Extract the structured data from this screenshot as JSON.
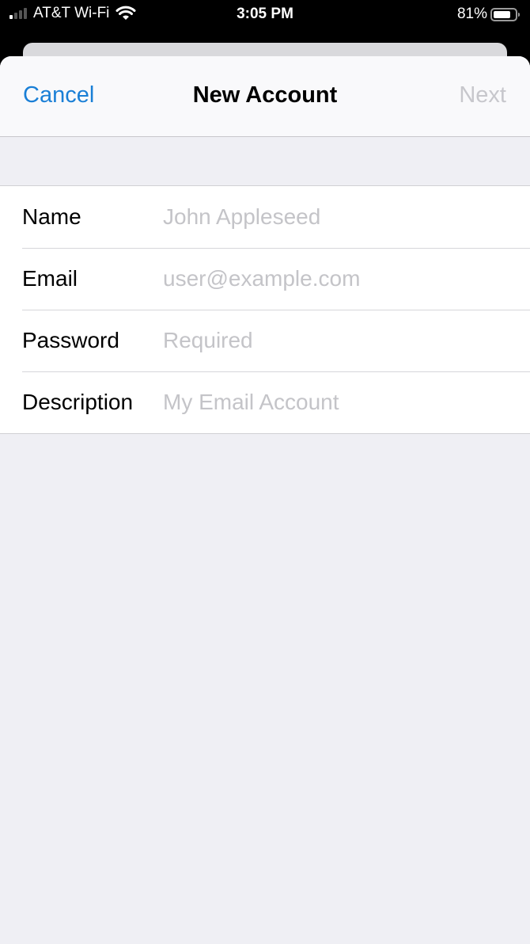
{
  "status_bar": {
    "carrier": "AT&T Wi-Fi",
    "time": "3:05 PM",
    "battery_percent": "81%",
    "battery_level": 0.81,
    "signal_bars": 1,
    "signal_icon": "cellular-signal-icon",
    "wifi_icon": "wifi-icon",
    "battery_icon": "battery-icon"
  },
  "navbar": {
    "cancel_label": "Cancel",
    "title": "New Account",
    "next_label": "Next"
  },
  "form": {
    "fields": [
      {
        "label": "Name",
        "placeholder": "John Appleseed",
        "value": ""
      },
      {
        "label": "Email",
        "placeholder": "user@example.com",
        "value": ""
      },
      {
        "label": "Password",
        "placeholder": "Required",
        "value": ""
      },
      {
        "label": "Description",
        "placeholder": "My Email Account",
        "value": ""
      }
    ]
  },
  "colors": {
    "accent": "#1a7fd6",
    "disabled": "#c7c7cc",
    "background": "#efeff4"
  }
}
